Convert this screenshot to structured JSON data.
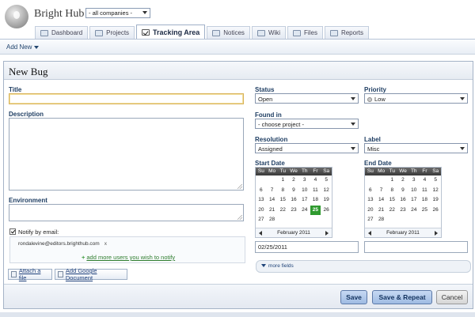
{
  "header": {
    "app_title": "Bright Hub",
    "company_select": "- all companies -"
  },
  "tabs": [
    {
      "label": "Dashboard",
      "active": false
    },
    {
      "label": "Projects",
      "active": false
    },
    {
      "label": "Tracking Area",
      "active": true
    },
    {
      "label": "Notices",
      "active": false
    },
    {
      "label": "Wiki",
      "active": false
    },
    {
      "label": "Files",
      "active": false
    },
    {
      "label": "Reports",
      "active": false
    }
  ],
  "toolbar": {
    "add_new": "Add New"
  },
  "form": {
    "title": "New Bug",
    "title_label": "Title",
    "title_value": "",
    "description_label": "Description",
    "environment_label": "Environment",
    "notify_label": "Notify by email:",
    "notify_email": "rondalevine@editors.brighthub.com",
    "notify_remove": "x",
    "add_users": "add more users you wish to notify",
    "attach_file": "Attach a file",
    "add_google_doc": "Add Google Document",
    "status_label": "Status",
    "status_value": "Open",
    "priority_label": "Priority",
    "priority_value": "Low",
    "found_in_label": "Found in",
    "found_in_value": "- choose project -",
    "resolution_label": "Resolution",
    "resolution_value": "Assigned",
    "label_label": "Label",
    "label_value": "Misc",
    "start_date_label": "Start Date",
    "end_date_label": "End Date",
    "start_date_value": "02/25/2011",
    "end_date_value": "",
    "more_fields": "more fields"
  },
  "calendar": {
    "weekdays": [
      "Su",
      "Mo",
      "Tu",
      "We",
      "Th",
      "Fr",
      "Sa"
    ],
    "month_label": "February 2011",
    "days": [
      "",
      "",
      "1",
      "2",
      "3",
      "4",
      "5",
      "6",
      "7",
      "8",
      "9",
      "10",
      "11",
      "12",
      "13",
      "14",
      "15",
      "16",
      "17",
      "18",
      "19",
      "20",
      "21",
      "22",
      "23",
      "24",
      "25",
      "26",
      "27",
      "28",
      "",
      "",
      "",
      "",
      ""
    ],
    "start_selected": "25"
  },
  "buttons": {
    "save": "Save",
    "save_repeat": "Save & Repeat",
    "cancel": "Cancel"
  }
}
